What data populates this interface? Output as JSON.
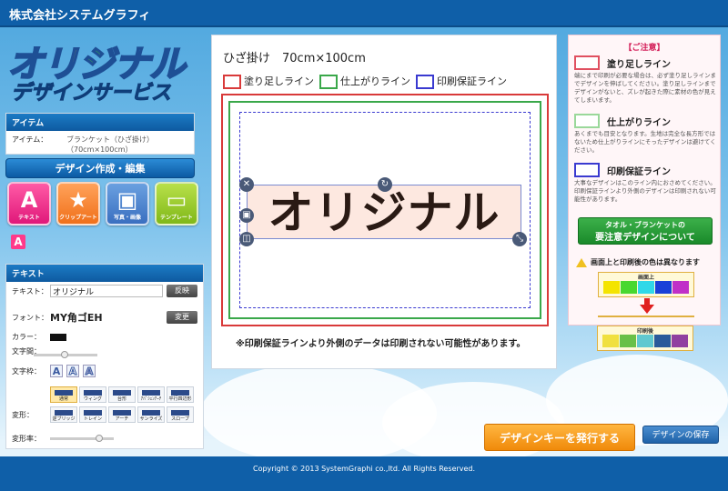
{
  "header": {
    "company": "株式会社システムグラフィ"
  },
  "logo": {
    "line1_chars": [
      "オ",
      "リ",
      "ジ",
      "ナ",
      "ル"
    ],
    "line1_colors": [
      "#2f86d6",
      "#f0c020",
      "#3cb84a",
      "#2f86d6",
      "#f08a0a"
    ],
    "line2": "デザインサービス"
  },
  "item": {
    "title": "アイテム",
    "label": "アイテム：",
    "value_line1": "ブランケット（ひざ掛け）",
    "value_line2": "（70cm×100cm）"
  },
  "design_button": "デザイン作成・編集",
  "tools": [
    {
      "glyph": "A",
      "label": "テキスト"
    },
    {
      "glyph": "★",
      "label": "クリップアート"
    },
    {
      "glyph": "▣",
      "label": "写真・画像"
    },
    {
      "glyph": "▭",
      "label": "テンプレート"
    }
  ],
  "active_tool_glyph": "A",
  "text_panel": {
    "title": "テキスト",
    "text_label": "テキスト：",
    "text_value": "オリジナル",
    "apply_button": "反映",
    "font_label": "フォント：",
    "font_value": "MY角ゴEH",
    "change_button": "変更",
    "color_label": "カラー：",
    "spacing_label": "文字間：",
    "outline_label": "文字枠：",
    "outline_options": [
      "A",
      "A",
      "A"
    ],
    "warp_label": "変形：",
    "warp_options": [
      "通常",
      "ウィング",
      "台形",
      "ｱﾊﾟｼｪﾝｱｰﾁ",
      "平行四辺形",
      "逆ブリッジ",
      "トレイン",
      "アーチ",
      "サンライズ",
      "スロープ"
    ],
    "warp_rate_label": "変形率："
  },
  "canvas": {
    "size_title": "ひざ掛け　70cm×100cm",
    "legend": [
      {
        "label": "塗り足しライン",
        "color": "#d93a3a"
      },
      {
        "label": "仕上がりライン",
        "color": "#3aa84a"
      },
      {
        "label": "印刷保証ライン",
        "color": "#3a3ad0"
      }
    ],
    "text_object": "オリジナル",
    "note": "※印刷保証ラインより外側のデータは印刷されない可能性があります。"
  },
  "notice": {
    "title": "【ご注意】",
    "items": [
      {
        "label": "塗り足しライン",
        "color": "#e05060",
        "desc": "端にまで印刷が必要な場合は、必ず塗り足しラインまでデザインを伸ばしてください。塗り足しラインまでデザインがないと、ズレが起きた際に素材の色が見えてしまいます。"
      },
      {
        "label": "仕上がりライン",
        "color": "#9ad89a",
        "desc": "あくまでも目安となります。生地は完全な長方形ではないため仕上がりラインにそったデザインは避けてください。"
      },
      {
        "label": "印刷保証ライン",
        "color": "#3a3ad0",
        "desc": "大事なデザインはこのライン内におさめてください。印刷保証ラインより外側のデザインは印刷されない可能性があります。"
      }
    ],
    "caution_button_line1": "タオル・ブランケットの",
    "caution_button_line2": "要注意デザインについて",
    "diff_title": "画面上と印刷後の色は異なります",
    "screen_label": "画面上",
    "print_label": "印刷後",
    "screen_colors": [
      "#f4e400",
      "#48d830",
      "#30d8e8",
      "#1a40d8",
      "#c030c8"
    ],
    "print_colors": [
      "#f0e040",
      "#68c048",
      "#60c8d0",
      "#2a5a9a",
      "#9040a0"
    ]
  },
  "actions": {
    "issue_key": "デザインキーを発行する",
    "save": "デザインの保存"
  },
  "footer": "Copyright © 2013 SystemGraphi co.,ltd. All Rights Reserved."
}
